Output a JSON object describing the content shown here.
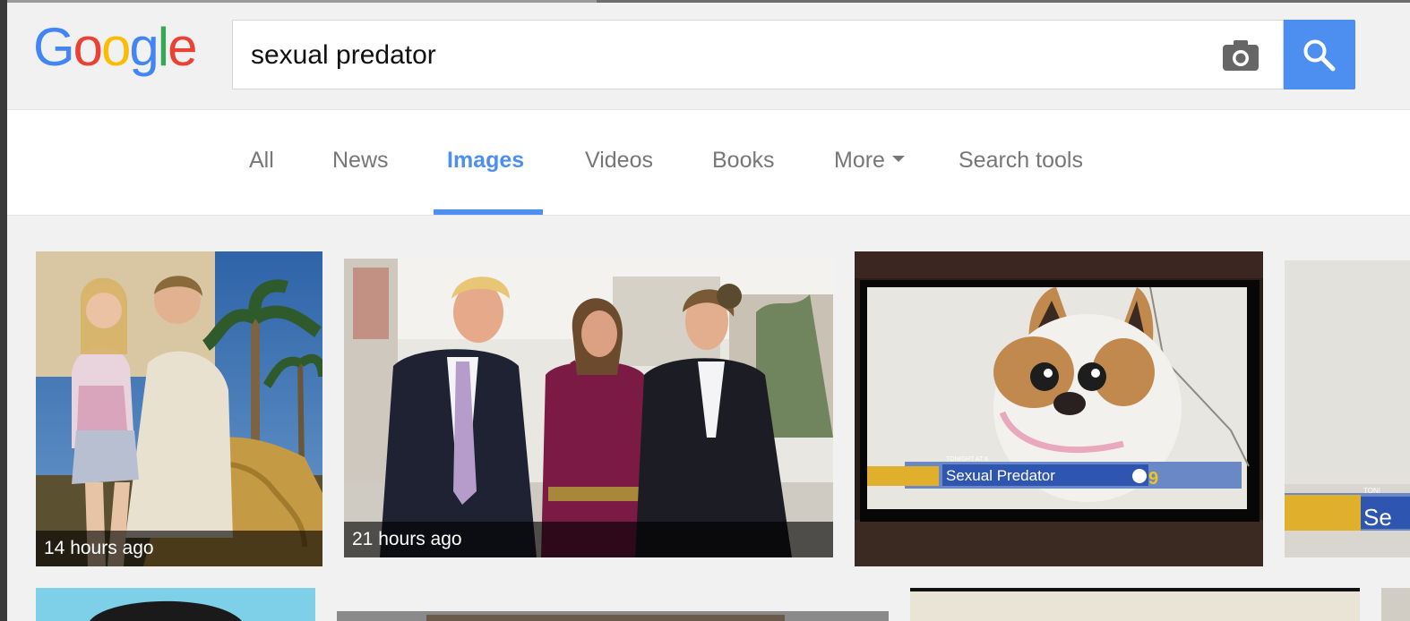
{
  "logo": {
    "letters": [
      "G",
      "o",
      "o",
      "g",
      "l",
      "e"
    ],
    "colors": [
      "#4285f4",
      "#ea4335",
      "#fbbc05",
      "#4285f4",
      "#34a853",
      "#ea4335"
    ]
  },
  "search": {
    "query": "sexual predator"
  },
  "tabs": [
    {
      "label": "All"
    },
    {
      "label": "News"
    },
    {
      "label": "Images"
    },
    {
      "label": "Videos"
    },
    {
      "label": "Books"
    },
    {
      "label": "More"
    },
    {
      "label": "Search tools"
    }
  ],
  "results": [
    {
      "timestamp": "14 hours ago"
    },
    {
      "timestamp": "21 hours ago"
    },
    {
      "overlay_small": "TONIGHT AT 6",
      "overlay_title": "Sexual Predator",
      "channel": "9"
    },
    {
      "overlay_small": "TONI",
      "overlay_title": "Se"
    }
  ],
  "colors": {
    "accent": "#4d8ff1",
    "page_bg": "#f1f1f1"
  },
  "icons": [
    "camera-icon",
    "search-icon",
    "chevron-down-icon"
  ]
}
